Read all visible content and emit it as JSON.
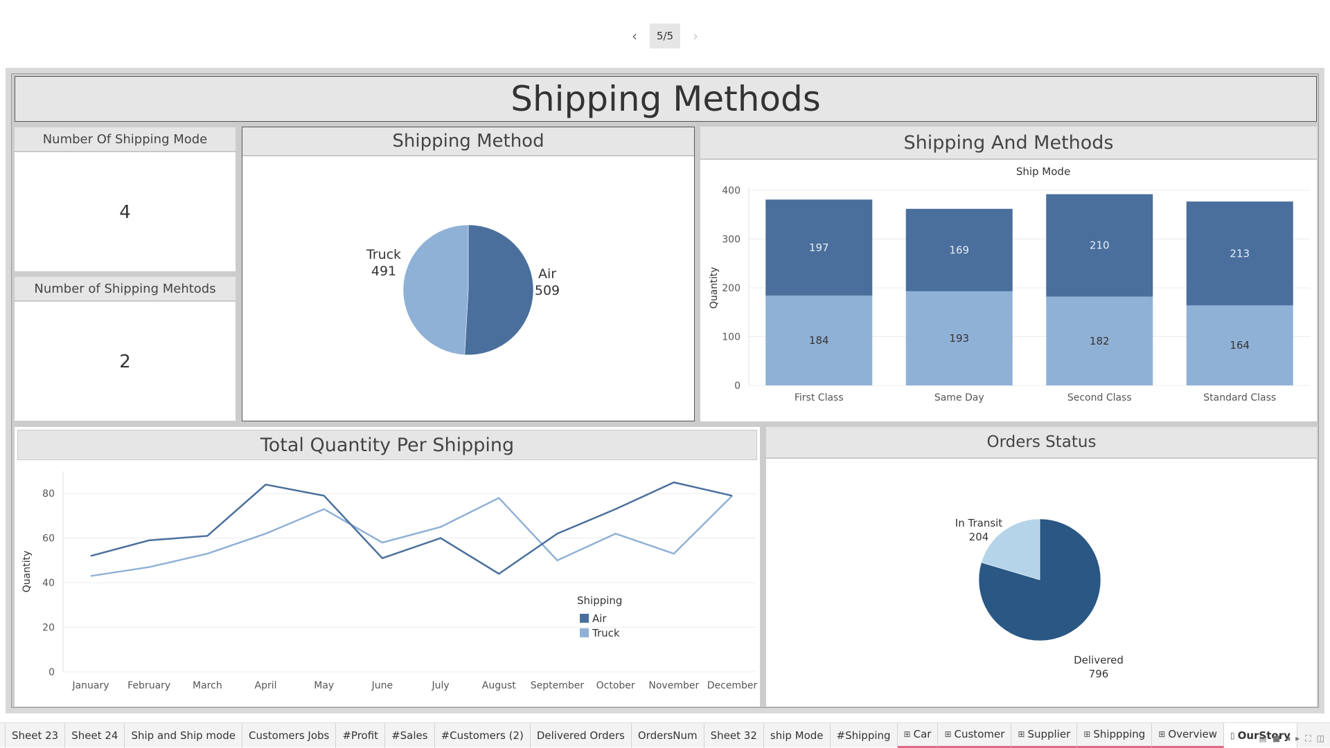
{
  "story": {
    "page_indicator": "5/5",
    "prev_icon": "chevron-left-icon",
    "next_icon": "chevron-right-icon"
  },
  "dashboard": {
    "title": "Shipping Methods",
    "kpis": [
      {
        "label": "Number Of Shipping Mode",
        "value": "4"
      },
      {
        "label": "Number of Shipping Mehtods",
        "value": "2"
      }
    ]
  },
  "colors": {
    "dark_blue": "#4a6f9c",
    "light_blue": "#90b1d6",
    "delivered": "#2a5783",
    "in_transit": "#b5d4ea",
    "panel_header": "#e6e6e6"
  },
  "chart_data": [
    {
      "type": "pie",
      "title": "Shipping Method",
      "slices": [
        {
          "label": "Air",
          "value": 509,
          "color": "#4a6f9c"
        },
        {
          "label": "Truck",
          "value": 491,
          "color": "#90b1d6"
        }
      ]
    },
    {
      "type": "bar",
      "stacked": true,
      "title": "Shipping And Methods",
      "xlabel": "Ship Mode",
      "ylabel": "Quantity",
      "ylim": [
        0,
        400
      ],
      "yticks": [
        0,
        100,
        200,
        300,
        400
      ],
      "categories": [
        "First Class",
        "Same Day",
        "Second Class",
        "Standard Class"
      ],
      "series": [
        {
          "values": [
            184,
            193,
            182,
            164
          ],
          "color": "#90b1d6"
        },
        {
          "values": [
            197,
            169,
            210,
            213
          ],
          "color": "#4a6f9c"
        }
      ],
      "grid": true
    },
    {
      "type": "line",
      "title": "Total Quantity Per Shipping",
      "ylabel": "Quantity",
      "ylim": [
        0,
        90
      ],
      "yticks": [
        0,
        20,
        40,
        60,
        80
      ],
      "x": [
        "January",
        "February",
        "March",
        "April",
        "May",
        "June",
        "July",
        "August",
        "September",
        "October",
        "November",
        "December"
      ],
      "legend": {
        "title": "Shipping",
        "placement": "inside-right"
      },
      "series": [
        {
          "name": "Air",
          "values": [
            52,
            59,
            61,
            84,
            79,
            51,
            60,
            44,
            62,
            73,
            85,
            79
          ],
          "color": "#4a6f9c"
        },
        {
          "name": "Truck",
          "values": [
            43,
            47,
            53,
            62,
            73,
            58,
            65,
            78,
            50,
            62,
            53,
            79
          ],
          "color": "#90b1d6"
        }
      ],
      "grid": true
    },
    {
      "type": "pie",
      "title": "Orders Status",
      "slices": [
        {
          "label": "Delivered",
          "value": 796,
          "color": "#2a5783"
        },
        {
          "label": "In Transit",
          "value": 204,
          "color": "#b5d4ea"
        }
      ]
    }
  ],
  "tabs": [
    {
      "label": "Sheet 23",
      "kind": "sheet"
    },
    {
      "label": "Sheet 24",
      "kind": "sheet"
    },
    {
      "label": "Ship and Ship mode",
      "kind": "sheet"
    },
    {
      "label": "Customers Jobs",
      "kind": "sheet"
    },
    {
      "label": "#Profit",
      "kind": "sheet"
    },
    {
      "label": "#Sales",
      "kind": "sheet"
    },
    {
      "label": "#Customers (2)",
      "kind": "sheet"
    },
    {
      "label": "Delivered Orders",
      "kind": "sheet"
    },
    {
      "label": "OrdersNum",
      "kind": "sheet"
    },
    {
      "label": "Sheet 32",
      "kind": "sheet"
    },
    {
      "label": "ship Mode",
      "kind": "sheet"
    },
    {
      "label": "#Shipping",
      "kind": "sheet"
    },
    {
      "label": "Car",
      "kind": "dashboard"
    },
    {
      "label": "Customer",
      "kind": "dashboard"
    },
    {
      "label": "Supplier",
      "kind": "dashboard"
    },
    {
      "label": "Shippping",
      "kind": "dashboard"
    },
    {
      "label": "Overview",
      "kind": "dashboard"
    },
    {
      "label": "OurStory",
      "kind": "story",
      "active": true
    }
  ]
}
